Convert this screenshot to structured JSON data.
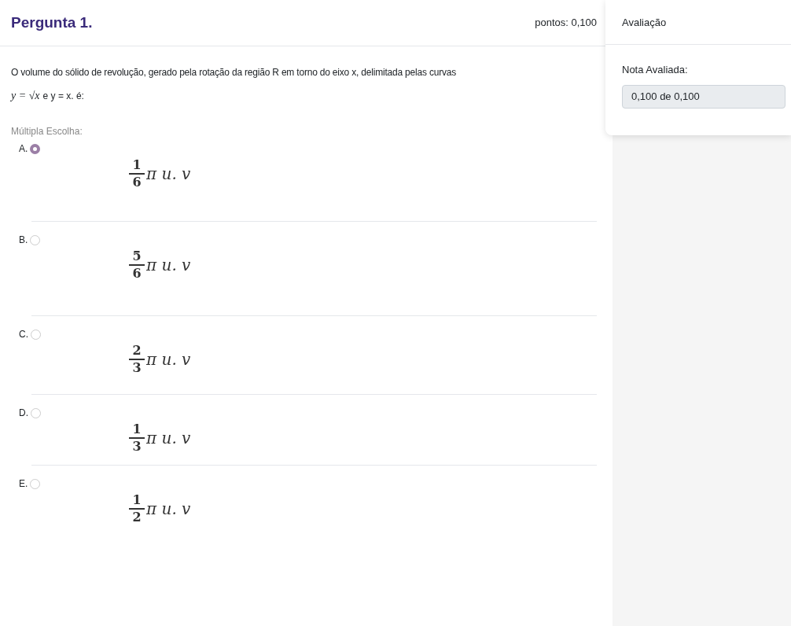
{
  "question": {
    "title": "Pergunta 1.",
    "points": "pontos: 0,100",
    "text": "O volume do sólido de revolução, gerado pela rotação da região R em torno do eixo x, delimitada pelas curvas",
    "formula": "y = √x",
    "formula_tail": "e y = x. é:",
    "type_label": "Múltipla Escolha:"
  },
  "options": [
    {
      "letter": "A.",
      "selected": true,
      "numerator": "1",
      "denominator": "6",
      "rest": "π u. v"
    },
    {
      "letter": "B.",
      "selected": false,
      "numerator": "5",
      "denominator": "6",
      "rest": "π u. v"
    },
    {
      "letter": "C.",
      "selected": false,
      "numerator": "2",
      "denominator": "3",
      "rest": "π u. v"
    },
    {
      "letter": "D.",
      "selected": false,
      "numerator": "1",
      "denominator": "3",
      "rest": "π u. v"
    },
    {
      "letter": "E.",
      "selected": false,
      "numerator": "1",
      "denominator": "2",
      "rest": "π u. v"
    }
  ],
  "evaluation": {
    "title": "Avaliação",
    "grade_label": "Nota Avaliada:",
    "grade_value": "0,100 de 0,100"
  }
}
